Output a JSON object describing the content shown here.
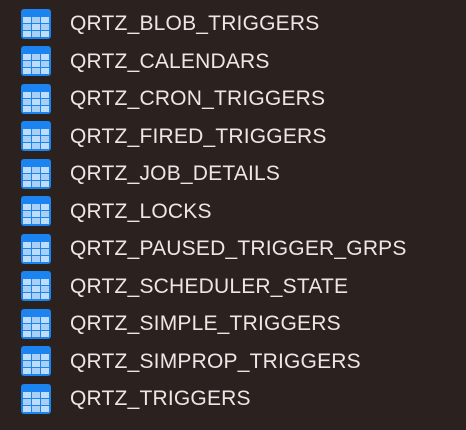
{
  "tables": {
    "icon": "table-icon",
    "colors": {
      "background": "#2b2220",
      "text": "#ece6e4",
      "icon_header": "#1c84f0",
      "icon_cell": "#bfdcfa",
      "icon_cell_alt": "#a8cff6"
    },
    "items": [
      {
        "name": "QRTZ_BLOB_TRIGGERS"
      },
      {
        "name": "QRTZ_CALENDARS"
      },
      {
        "name": "QRTZ_CRON_TRIGGERS"
      },
      {
        "name": "QRTZ_FIRED_TRIGGERS"
      },
      {
        "name": "QRTZ_JOB_DETAILS"
      },
      {
        "name": "QRTZ_LOCKS"
      },
      {
        "name": "QRTZ_PAUSED_TRIGGER_GRPS"
      },
      {
        "name": "QRTZ_SCHEDULER_STATE"
      },
      {
        "name": "QRTZ_SIMPLE_TRIGGERS"
      },
      {
        "name": "QRTZ_SIMPROP_TRIGGERS"
      },
      {
        "name": "QRTZ_TRIGGERS"
      }
    ]
  }
}
